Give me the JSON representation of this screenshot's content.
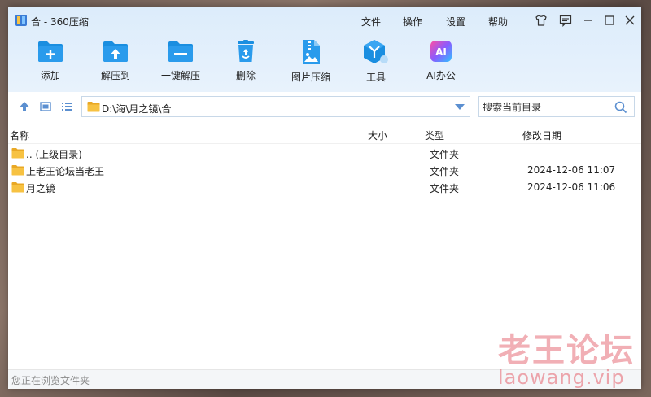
{
  "window": {
    "title": "合 - 360压缩"
  },
  "menu": {
    "file": "文件",
    "operate": "操作",
    "settings": "设置",
    "help": "帮助"
  },
  "toolbar": {
    "add": "添加",
    "extract_to": "解压到",
    "one_click_extract": "一键解压",
    "delete": "删除",
    "image_compress": "图片压缩",
    "tools": "工具",
    "ai_office": "AI办公",
    "ai_badge": "AI"
  },
  "address": {
    "path": "D:\\海\\月之镜\\合"
  },
  "search": {
    "placeholder": "搜索当前目录"
  },
  "columns": {
    "name": "名称",
    "size": "大小",
    "type": "类型",
    "modified": "修改日期"
  },
  "files": [
    {
      "name": ".. (上级目录)",
      "type": "文件夹",
      "modified": ""
    },
    {
      "name": "上老王论坛当老王",
      "type": "文件夹",
      "modified": "2024-12-06 11:07"
    },
    {
      "name": "月之镜",
      "type": "文件夹",
      "modified": "2024-12-06 11:06"
    }
  ],
  "status": {
    "text": "您正在浏览文件夹"
  },
  "watermark": {
    "cn": "老王论坛",
    "url": "laowang.vip"
  },
  "colors": {
    "accent": "#1a8ee0",
    "folder": "#f7c242",
    "topband": "#dcecfb",
    "watermark": "#e66e78"
  }
}
